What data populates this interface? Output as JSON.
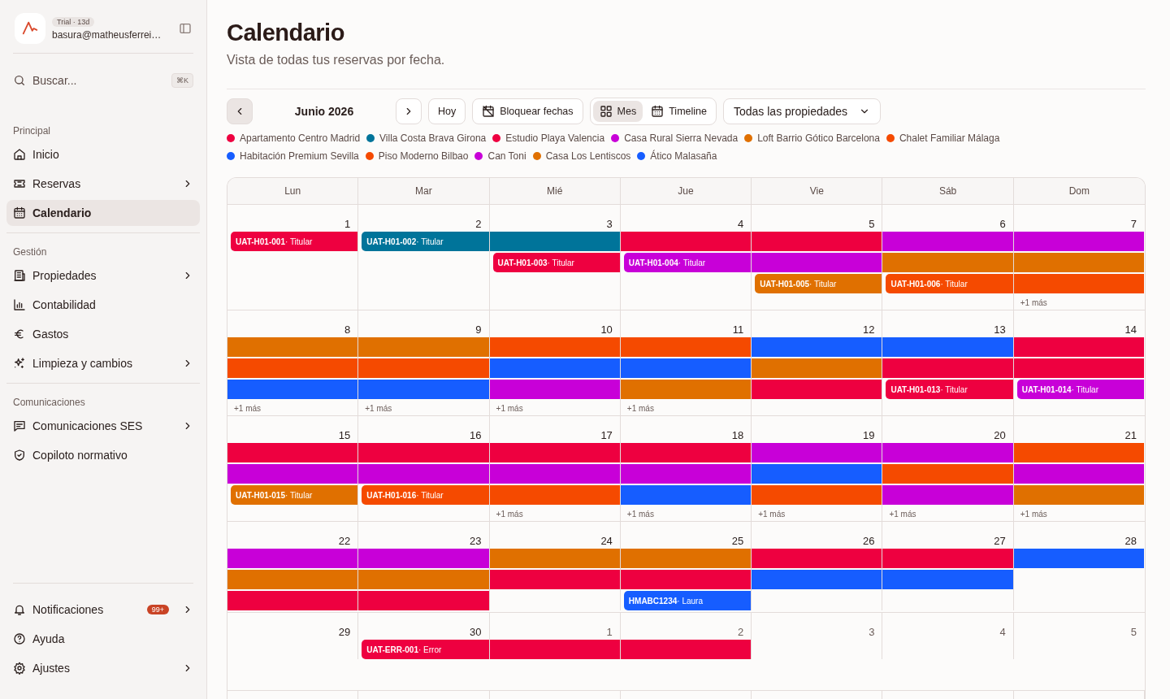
{
  "sidebar": {
    "account": {
      "plan_badge": "Trial · 13d",
      "email": "basura@matheusferrei…"
    },
    "search": {
      "label": "Buscar...",
      "shortcut": "⌘K"
    },
    "sections": [
      {
        "heading": "Principal",
        "items": [
          {
            "label": "Inicio",
            "selected": false,
            "has_submenu": false
          },
          {
            "label": "Reservas",
            "selected": false,
            "has_submenu": true
          },
          {
            "label": "Calendario",
            "selected": true,
            "has_submenu": false
          }
        ]
      },
      {
        "heading": "Gestión",
        "items": [
          {
            "label": "Propiedades",
            "selected": false,
            "has_submenu": true
          },
          {
            "label": "Contabilidad",
            "selected": false,
            "has_submenu": false
          },
          {
            "label": "Gastos",
            "selected": false,
            "has_submenu": false
          },
          {
            "label": "Limpieza y cambios",
            "selected": false,
            "has_submenu": true
          }
        ]
      },
      {
        "heading": "Comunicaciones",
        "items": [
          {
            "label": "Comunicaciones SES",
            "selected": false,
            "has_submenu": true
          },
          {
            "label": "Copiloto normativo",
            "selected": false,
            "has_submenu": false
          }
        ]
      }
    ],
    "footer_items": [
      {
        "label": "Notificaciones",
        "badge": "99+",
        "has_submenu": true
      },
      {
        "label": "Ayuda",
        "has_submenu": false
      },
      {
        "label": "Ajustes",
        "has_submenu": true
      }
    ]
  },
  "page": {
    "title": "Calendario",
    "subtitle": "Vista de todas tus reservas por fecha."
  },
  "toolbar": {
    "month": "Junio 2026",
    "today_button": "Hoy",
    "block_button": "Bloquear fechas",
    "views": [
      {
        "label": "Mes",
        "selected": true
      },
      {
        "label": "Timeline",
        "selected": false
      }
    ],
    "property_filter": "Todas las propiedades"
  },
  "legend": [
    {
      "label": "Apartamento Centro Madrid",
      "color": "#ee0040"
    },
    {
      "label": "Villa Costa Brava Girona",
      "color": "#00749a"
    },
    {
      "label": "Estudio Playa Valencia",
      "color": "#ee0040"
    },
    {
      "label": "Casa Rural Sierra Nevada",
      "color": "#c800d8"
    },
    {
      "label": "Loft Barrio Gótico Barcelona",
      "color": "#e07000"
    },
    {
      "label": "Chalet Familiar Málaga",
      "color": "#f54a00"
    },
    {
      "label": "Habitación Premium Sevilla",
      "color": "#165dff"
    },
    {
      "label": "Piso Moderno Bilbao",
      "color": "#f54a00"
    },
    {
      "label": "Can Toni",
      "color": "#c800d8"
    },
    {
      "label": "Casa Los Lentiscos",
      "color": "#e07000"
    },
    {
      "label": "Ático Malasaña",
      "color": "#165dff"
    }
  ],
  "calendar": {
    "weekdays": [
      "Lun",
      "Mar",
      "Mié",
      "Jue",
      "Vie",
      "Sáb",
      "Dom"
    ],
    "weeks": [
      {
        "days": [
          {
            "date": "1",
            "muted": false
          },
          {
            "date": "2",
            "muted": false
          },
          {
            "date": "3",
            "muted": false
          },
          {
            "date": "4",
            "muted": false
          },
          {
            "date": "5",
            "muted": false
          },
          {
            "date": "6",
            "muted": false
          },
          {
            "date": "7",
            "muted": false,
            "more": "+1 más"
          }
        ],
        "lanes": [
          [
            {
              "kind": "bar",
              "color": "#ee0040",
              "start": true,
              "label": "**UAT-H01-001**· Titular"
            },
            {
              "kind": "bar",
              "color": "#00749a",
              "start": true,
              "label": "**UAT-H01-002**· Titular"
            },
            {
              "kind": "bar",
              "color": "#00749a",
              "start": false
            },
            {
              "kind": "bar",
              "color": "#ee0040",
              "start": false
            },
            {
              "kind": "bar",
              "color": "#ee0040",
              "start": false
            },
            {
              "kind": "bar",
              "color": "#c800d8",
              "start": false
            },
            {
              "kind": "bar",
              "color": "#c800d8",
              "start": false
            }
          ],
          [
            {
              "kind": "gap"
            },
            {
              "kind": "gap"
            },
            {
              "kind": "bar",
              "color": "#ee0040",
              "start": true,
              "label": "**UAT-H01-003**· Titular"
            },
            {
              "kind": "bar",
              "color": "#c800d8",
              "start": true,
              "label": "**UAT-H01-004**· Titular"
            },
            {
              "kind": "bar",
              "color": "#c800d8",
              "start": false
            },
            {
              "kind": "bar",
              "color": "#e07000",
              "start": false
            },
            {
              "kind": "bar",
              "color": "#e07000",
              "start": false
            }
          ],
          [
            {
              "kind": "gap"
            },
            {
              "kind": "gap"
            },
            {
              "kind": "gap"
            },
            {
              "kind": "gap"
            },
            {
              "kind": "bar",
              "color": "#e07000",
              "start": true,
              "label": "**UAT-H01-005**· Titular"
            },
            {
              "kind": "bar",
              "color": "#f54a00",
              "start": true,
              "label": "**UAT-H01-006**· Titular"
            },
            {
              "kind": "bar",
              "color": "#f54a00",
              "start": false
            }
          ]
        ]
      },
      {
        "days": [
          {
            "date": "8",
            "muted": false,
            "more": "+1 más"
          },
          {
            "date": "9",
            "muted": false,
            "more": "+1 más"
          },
          {
            "date": "10",
            "muted": false,
            "more": "+1 más"
          },
          {
            "date": "11",
            "muted": false,
            "more": "+1 más"
          },
          {
            "date": "12",
            "muted": false
          },
          {
            "date": "13",
            "muted": false
          },
          {
            "date": "14",
            "muted": false
          }
        ],
        "lanes": [
          [
            {
              "kind": "bar",
              "color": "#e07000",
              "start": false
            },
            {
              "kind": "bar",
              "color": "#e07000",
              "start": false
            },
            {
              "kind": "bar",
              "color": "#f54a00",
              "start": false
            },
            {
              "kind": "bar",
              "color": "#f54a00",
              "start": false
            },
            {
              "kind": "bar",
              "color": "#165dff",
              "start": false
            },
            {
              "kind": "bar",
              "color": "#165dff",
              "start": false
            },
            {
              "kind": "bar",
              "color": "#ee0040",
              "start": false
            }
          ],
          [
            {
              "kind": "bar",
              "color": "#f54a00",
              "start": false
            },
            {
              "kind": "bar",
              "color": "#f54a00",
              "start": false
            },
            {
              "kind": "bar",
              "color": "#165dff",
              "start": false
            },
            {
              "kind": "bar",
              "color": "#165dff",
              "start": false
            },
            {
              "kind": "bar",
              "color": "#e07000",
              "start": false
            },
            {
              "kind": "bar",
              "color": "#ee0040",
              "start": false
            },
            {
              "kind": "bar",
              "color": "#ee0040",
              "start": false
            }
          ],
          [
            {
              "kind": "bar",
              "color": "#165dff",
              "start": false
            },
            {
              "kind": "bar",
              "color": "#165dff",
              "start": false
            },
            {
              "kind": "bar",
              "color": "#c800d8",
              "start": false
            },
            {
              "kind": "bar",
              "color": "#e07000",
              "start": false
            },
            {
              "kind": "bar",
              "color": "#ee0040",
              "start": false
            },
            {
              "kind": "bar",
              "color": "#ee0040",
              "start": true,
              "label": "**UAT-H01-013**· Titular"
            },
            {
              "kind": "bar",
              "color": "#c800d8",
              "start": true,
              "label": "**UAT-H01-014**· Titular"
            }
          ]
        ]
      },
      {
        "days": [
          {
            "date": "15",
            "muted": false
          },
          {
            "date": "16",
            "muted": false
          },
          {
            "date": "17",
            "muted": false,
            "more": "+1 más"
          },
          {
            "date": "18",
            "muted": false,
            "more": "+1 más"
          },
          {
            "date": "19",
            "muted": false,
            "more": "+1 más"
          },
          {
            "date": "20",
            "muted": false,
            "more": "+1 más"
          },
          {
            "date": "21",
            "muted": false,
            "more": "+1 más"
          }
        ],
        "lanes": [
          [
            {
              "kind": "bar",
              "color": "#ee0040",
              "start": false
            },
            {
              "kind": "bar",
              "color": "#ee0040",
              "start": false
            },
            {
              "kind": "bar",
              "color": "#ee0040",
              "start": false
            },
            {
              "kind": "bar",
              "color": "#ee0040",
              "start": false
            },
            {
              "kind": "bar",
              "color": "#c800d8",
              "start": false
            },
            {
              "kind": "bar",
              "color": "#c800d8",
              "start": false
            },
            {
              "kind": "bar",
              "color": "#f54a00",
              "start": false
            }
          ],
          [
            {
              "kind": "bar",
              "color": "#c800d8",
              "start": false
            },
            {
              "kind": "bar",
              "color": "#c800d8",
              "start": false
            },
            {
              "kind": "bar",
              "color": "#c800d8",
              "start": false
            },
            {
              "kind": "bar",
              "color": "#c800d8",
              "start": false
            },
            {
              "kind": "bar",
              "color": "#165dff",
              "start": false
            },
            {
              "kind": "bar",
              "color": "#f54a00",
              "start": false
            },
            {
              "kind": "bar",
              "color": "#c800d8",
              "start": false
            }
          ],
          [
            {
              "kind": "bar",
              "color": "#e07000",
              "start": true,
              "label": "**UAT-H01-015**· Titular"
            },
            {
              "kind": "bar",
              "color": "#f54a00",
              "start": true,
              "label": "**UAT-H01-016**· Titular"
            },
            {
              "kind": "bar",
              "color": "#f54a00",
              "start": false
            },
            {
              "kind": "bar",
              "color": "#165dff",
              "start": false
            },
            {
              "kind": "bar",
              "color": "#f54a00",
              "start": false
            },
            {
              "kind": "bar",
              "color": "#c800d8",
              "start": false
            },
            {
              "kind": "bar",
              "color": "#e07000",
              "start": false
            }
          ]
        ]
      },
      {
        "days": [
          {
            "date": "22",
            "muted": false
          },
          {
            "date": "23",
            "muted": false
          },
          {
            "date": "24",
            "muted": false
          },
          {
            "date": "25",
            "muted": false
          },
          {
            "date": "26",
            "muted": false
          },
          {
            "date": "27",
            "muted": false
          },
          {
            "date": "28",
            "muted": false
          }
        ],
        "lanes": [
          [
            {
              "kind": "bar",
              "color": "#c800d8",
              "start": false
            },
            {
              "kind": "bar",
              "color": "#c800d8",
              "start": false
            },
            {
              "kind": "bar",
              "color": "#e07000",
              "start": false
            },
            {
              "kind": "bar",
              "color": "#e07000",
              "start": false
            },
            {
              "kind": "bar",
              "color": "#ee0040",
              "start": false
            },
            {
              "kind": "bar",
              "color": "#ee0040",
              "start": false
            },
            {
              "kind": "bar",
              "color": "#165dff",
              "start": false
            }
          ],
          [
            {
              "kind": "bar",
              "color": "#e07000",
              "start": false
            },
            {
              "kind": "bar",
              "color": "#e07000",
              "start": false
            },
            {
              "kind": "bar",
              "color": "#ee0040",
              "start": false
            },
            {
              "kind": "bar",
              "color": "#ee0040",
              "start": false
            },
            {
              "kind": "bar",
              "color": "#165dff",
              "start": false
            },
            {
              "kind": "bar",
              "color": "#165dff",
              "start": false
            },
            {
              "kind": "gap"
            }
          ],
          [
            {
              "kind": "bar",
              "color": "#ee0040",
              "start": false
            },
            {
              "kind": "bar",
              "color": "#ee0040",
              "start": false
            },
            {
              "kind": "gap"
            },
            {
              "kind": "bar",
              "color": "#165dff",
              "start": true,
              "label": "**HMABC1234**· Laura"
            },
            {
              "kind": "gap"
            },
            {
              "kind": "gap"
            },
            {
              "kind": "gap"
            }
          ]
        ]
      },
      {
        "days": [
          {
            "date": "29",
            "muted": false
          },
          {
            "date": "30",
            "muted": false
          },
          {
            "date": "1",
            "muted": true
          },
          {
            "date": "2",
            "muted": true
          },
          {
            "date": "3",
            "muted": true
          },
          {
            "date": "4",
            "muted": true
          },
          {
            "date": "5",
            "muted": true
          }
        ],
        "lanes": [
          [
            {
              "kind": "gap"
            },
            {
              "kind": "bar",
              "color": "#ee0040",
              "start": true,
              "label": "**UAT-ERR-001**· Error"
            },
            {
              "kind": "bar",
              "color": "#ee0040",
              "start": false
            },
            {
              "kind": "bar",
              "color": "#ee0040",
              "start": false
            },
            {
              "kind": "gap"
            },
            {
              "kind": "gap"
            },
            {
              "kind": "gap"
            }
          ]
        ]
      }
    ]
  }
}
